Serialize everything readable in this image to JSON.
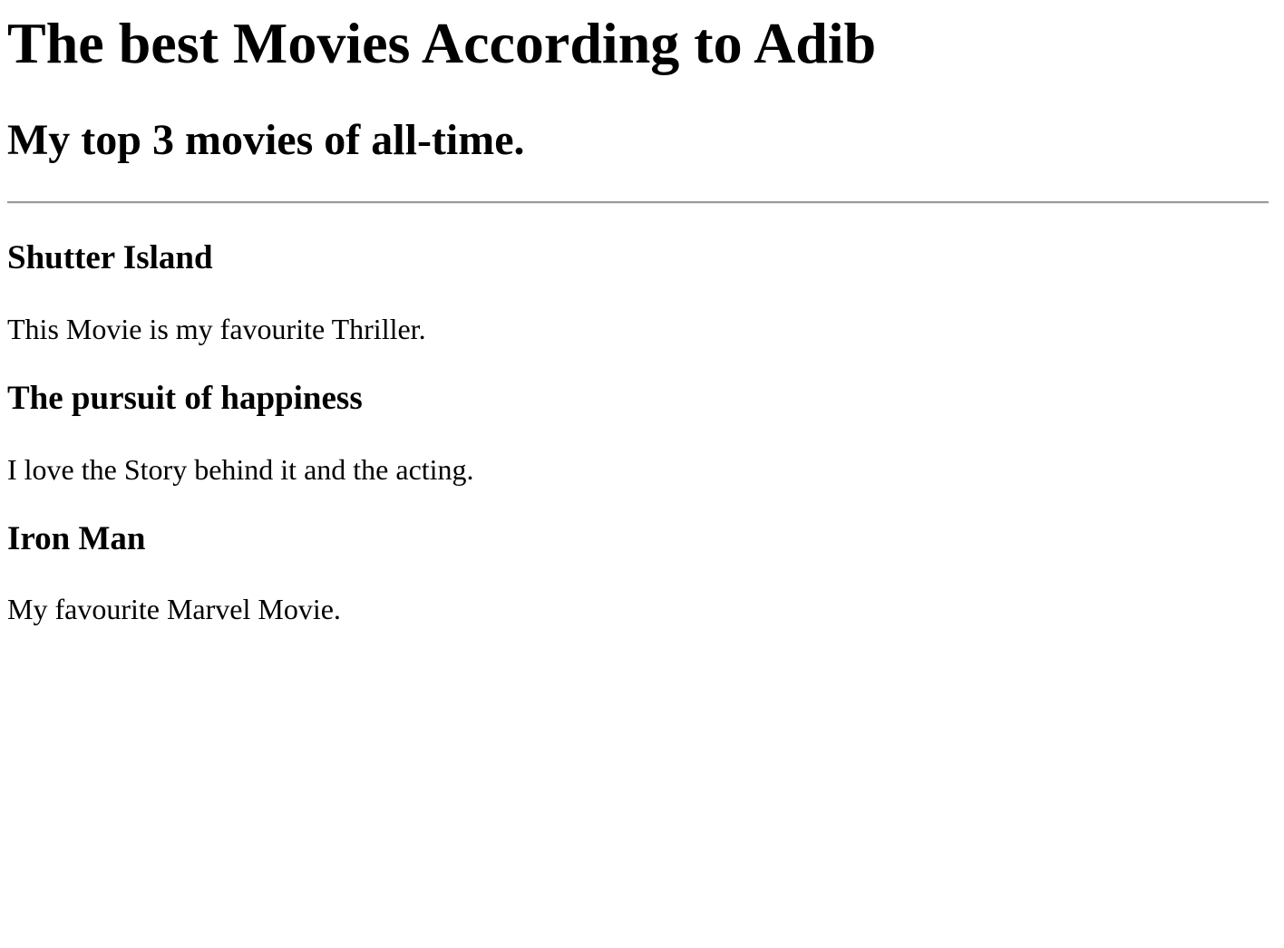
{
  "header": {
    "title": "The best Movies According to Adib",
    "subtitle": "My top 3 movies of all-time."
  },
  "movies": [
    {
      "title": "Shutter Island",
      "description": "This Movie is my favourite Thriller."
    },
    {
      "title": "The pursuit of happiness",
      "description": "I love the Story behind it and the acting."
    },
    {
      "title": "Iron Man",
      "description": "My favourite Marvel Movie."
    }
  ]
}
